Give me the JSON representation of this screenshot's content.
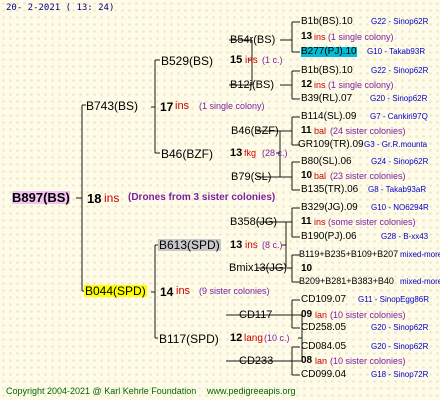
{
  "header": {
    "date": "20-  2-2021 ( 13: 24)"
  },
  "root": {
    "name": "B897(BS)",
    "gen": "18",
    "ins": "ins",
    "note": "(Drones from 3 sister colonies)"
  },
  "g1": [
    {
      "name": "B743(BS)",
      "gen": "17",
      "ins": "ins",
      "note": "(1 single colony)"
    },
    {
      "name": "B044(SPD)",
      "gen": "14",
      "ins": "ins",
      "note": "(9 sister colonies)"
    }
  ],
  "g2": [
    {
      "name": "B529(BS)",
      "gen": "15",
      "ins": "ins",
      "note": "(1 c.)"
    },
    {
      "name": "B46(BZF)",
      "gen": "13",
      "ins": "fkg",
      "note": "(28 c.)"
    },
    {
      "name": "B613(SPD)",
      "gen": "13",
      "ins": "ins",
      "note": "(8 c.)"
    },
    {
      "name": "B117(SPD)",
      "gen": "12",
      "ins": "lang",
      "note": "(10 c.)"
    }
  ],
  "g3": [
    {
      "name": "B54r(BS)"
    },
    {
      "name": "B12j(BS)"
    },
    {
      "name": "B46(BZF)"
    },
    {
      "name": "B79(SL)"
    },
    {
      "name": "B358(JG)"
    },
    {
      "name": "Bmix13(JG)"
    },
    {
      "name": "CD117"
    },
    {
      "name": "CD233"
    }
  ],
  "g4": [
    {
      "top": "B1b(BS).10",
      "top_info": "G22 - Sinop62R",
      "gen": "13",
      "ins": "ins",
      "note": "(1 single colony)",
      "bottom": "B277(PJ).10",
      "bottom_info": "G10 - Takab93R"
    },
    {
      "top": "B1b(BS).10",
      "top_info": "G22 - Sinop62R",
      "gen": "12",
      "ins": "ins",
      "note": "(1 single colony)",
      "bottom": "B39(RL).07",
      "bottom_info": "G20 - Sinop62R"
    },
    {
      "top": "B114(SL).09",
      "top_info": "G7 - Cankiri97Q",
      "gen": "11",
      "ins": "bal",
      "note": "(24 sister colonies)",
      "bottom": "GR109(TR).09",
      "bottom_info": "G3 - Gr.R.mounta"
    },
    {
      "top": "B80(SL).06",
      "top_info": "G24 - Sinop62R",
      "gen": "10",
      "ins": "bal",
      "note": "(23 sister colonies)",
      "bottom": "B135(TR).06",
      "bottom_info": "G8 - Takab93aR"
    },
    {
      "top": "B329(JG).09",
      "top_info": "G10 - NO6294R",
      "gen": "11",
      "ins": "ins",
      "note": "(some sister colonies)",
      "bottom": "B190(PJ).06",
      "bottom_info": "G28 - B-xx43"
    },
    {
      "top": "B119+B235+B109+B207",
      "top_info": "mixed-more",
      "gen": "10",
      "ins": "",
      "note": "",
      "bottom": "B209+B281+B383+B40",
      "bottom_info": "mixed-more"
    },
    {
      "top": "CD109.07",
      "top_info": "G11 - SinopEgg86R",
      "gen": "09",
      "ins": "lan",
      "note": "(10 sister colonies)",
      "bottom": "CD258.05",
      "bottom_info": "G20 - Sinop62R"
    },
    {
      "top": "CD084.05",
      "top_info": "G20 - Sinop62R",
      "gen": "08",
      "ins": "lan",
      "note": "(10 sister colonies)",
      "bottom": "CD099.04",
      "bottom_info": "G18 - Sinop72R"
    }
  ],
  "footer": {
    "copyright": "Copyright 2004-2021 @ Karl Kehrle Foundation",
    "url": "www.pedigreeapis.org"
  },
  "colors": {
    "background": "#fffbe8",
    "lines": "#1a1a1a",
    "ins": "#cc0000",
    "note": "#7b1fa2",
    "info": "#0000cc",
    "footer": "#006600",
    "root_highlight": "#f3c4f0",
    "yellow_highlight": "#ffff00",
    "gray_highlight": "#c8c8c8",
    "cyan_highlight": "#00bcd4"
  }
}
